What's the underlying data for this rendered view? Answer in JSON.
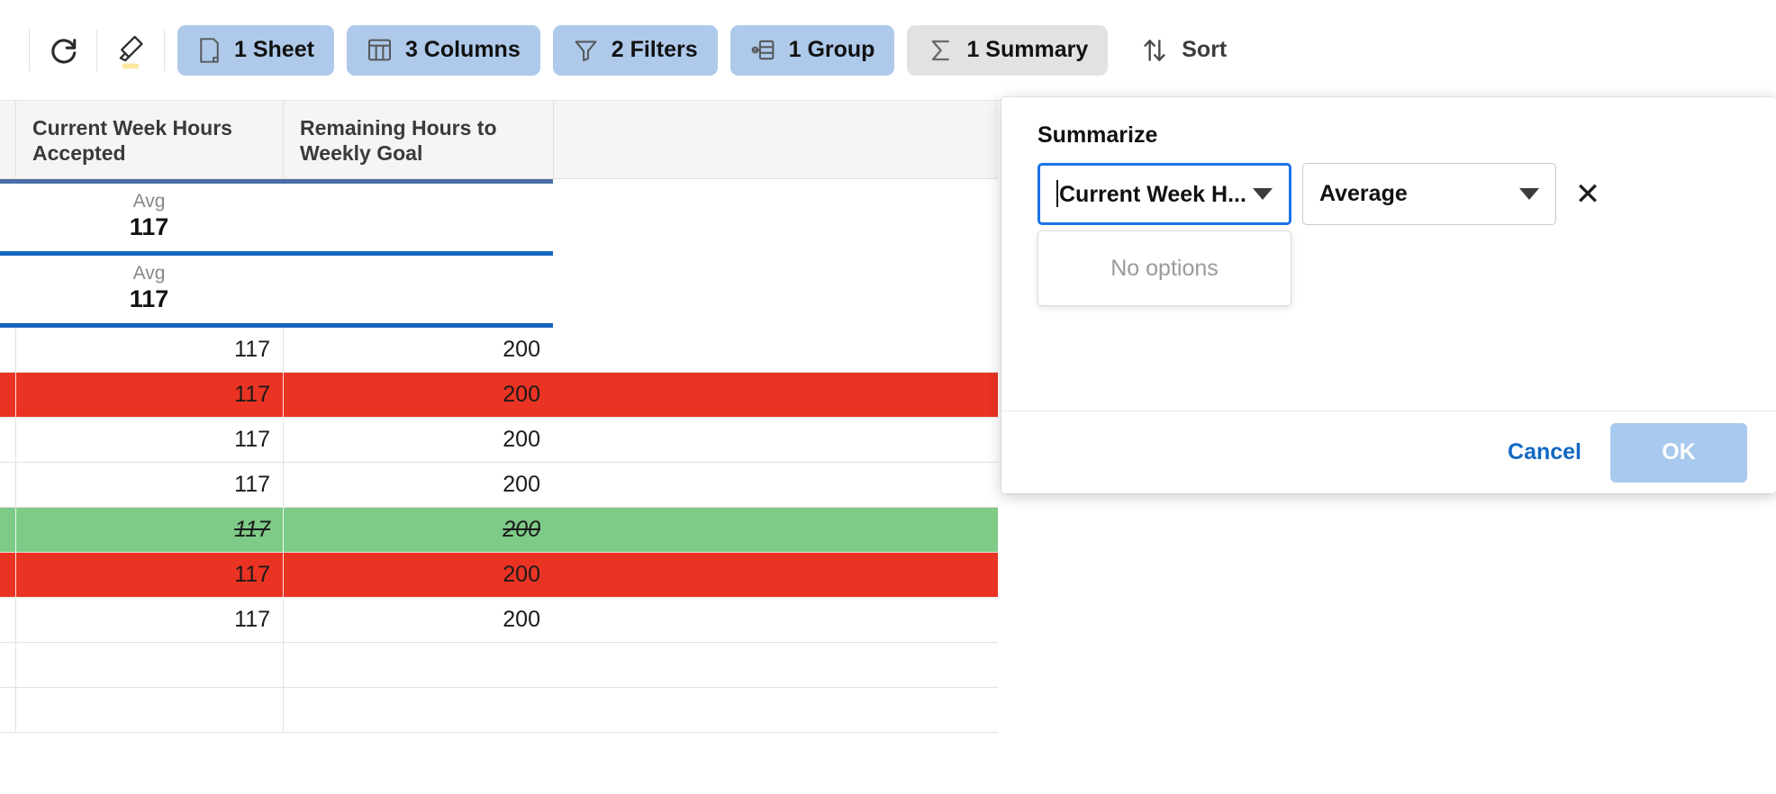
{
  "toolbar": {
    "refresh_icon": "refresh-icon",
    "highlighter_icon": "highlighter-icon",
    "chips": [
      {
        "icon": "sheet-icon",
        "label": "1 Sheet",
        "style": "blue"
      },
      {
        "icon": "columns-icon",
        "label": "3 Columns",
        "style": "blue"
      },
      {
        "icon": "filter-icon",
        "label": "2 Filters",
        "style": "blue"
      },
      {
        "icon": "group-icon",
        "label": "1 Group",
        "style": "blue"
      },
      {
        "icon": "sigma-icon",
        "label": "1 Summary",
        "style": "grey"
      },
      {
        "icon": "sort-icon",
        "label": "Sort",
        "style": "plain"
      }
    ]
  },
  "grid": {
    "columns": [
      {
        "header": ""
      },
      {
        "header": "Current Week Hours Accepted"
      },
      {
        "header": "Remaining Hours to Weekly Goal"
      },
      {
        "header": ""
      }
    ],
    "group_summaries": [
      {
        "label": "Avg",
        "value": "117",
        "divider": "slate"
      },
      {
        "label": "Avg",
        "value": "117",
        "divider": "blue"
      }
    ],
    "rows": [
      {
        "c1": "117",
        "c2": "200",
        "state": "normal"
      },
      {
        "c1": "117",
        "c2": "200",
        "state": "red"
      },
      {
        "c1": "117",
        "c2": "200",
        "state": "normal"
      },
      {
        "c1": "117",
        "c2": "200",
        "state": "normal"
      },
      {
        "c1": "117",
        "c2": "200",
        "state": "green-strike"
      },
      {
        "c1": "117",
        "c2": "200",
        "state": "red"
      },
      {
        "c1": "117",
        "c2": "200",
        "state": "normal"
      },
      {
        "c1": "",
        "c2": "",
        "state": "normal"
      },
      {
        "c1": "",
        "c2": "",
        "state": "normal"
      }
    ]
  },
  "popup": {
    "title": "Summarize",
    "field_select": {
      "value": "Current Week H...",
      "caret_icon": "chevron-down-icon",
      "has_text_cursor": true
    },
    "agg_select": {
      "value": "Average",
      "caret_icon": "chevron-down-icon"
    },
    "remove_icon": "close-icon",
    "dropdown": {
      "empty_text": "No options"
    },
    "cancel_label": "Cancel",
    "ok_label": "OK"
  },
  "colors": {
    "accent_blue": "#1a73e8",
    "chip_blue": "#aec9ea",
    "chip_grey": "#e2e2e2",
    "row_red": "#ea3323",
    "row_green": "#7ecb87",
    "divider_slate": "#4a6ea9",
    "divider_blue": "#1565c0",
    "link_blue": "#1268c3",
    "ok_button": "#a8caee"
  }
}
